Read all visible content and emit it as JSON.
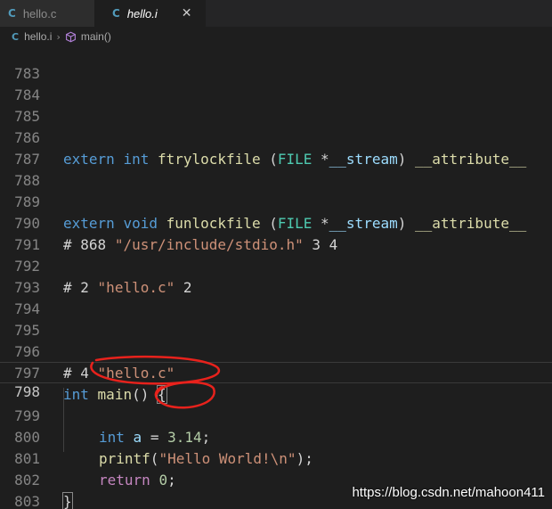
{
  "tabs": [
    {
      "icon": "C",
      "label": "hello.c",
      "active": false
    },
    {
      "icon": "C",
      "label": "hello.i",
      "active": true,
      "close": "✕"
    }
  ],
  "breadcrumb": {
    "file_icon": "C",
    "file": "hello.i",
    "separator": "›",
    "symbol": "main()"
  },
  "lines": {
    "l783": {
      "num": "783"
    },
    "l784": {
      "num": "784"
    },
    "l785": {
      "num": "785"
    },
    "l786": {
      "num": "786",
      "t1": "extern",
      "t2": "int",
      "t3": "ftrylockfile",
      "t4": "(",
      "t5": "FILE",
      "t6": " *",
      "t7": "__stream",
      "t8": ")",
      "t9": "__attribute__"
    },
    "l787": {
      "num": "787"
    },
    "l788": {
      "num": "788"
    },
    "l789": {
      "num": "789",
      "t1": "extern",
      "t2": "void",
      "t3": "funlockfile",
      "t4": "(",
      "t5": "FILE",
      "t6": " *",
      "t7": "__stream",
      "t8": ")",
      "t9": "__attribute__"
    },
    "l790": {
      "num": "790",
      "t1": "# 868",
      "t2": "\"/usr/include/stdio.h\"",
      "t3": "3 4"
    },
    "l791": {
      "num": "791"
    },
    "l792": {
      "num": "792",
      "t1": "# 2",
      "t2": "\"hello.c\"",
      "t3": "2"
    },
    "l793": {
      "num": "793"
    },
    "l794": {
      "num": "794"
    },
    "l795": {
      "num": "795"
    },
    "l796": {
      "num": "796",
      "t1": "# 4",
      "t2": "\"hello.c\""
    },
    "l797": {
      "num": "797",
      "t1": "int",
      "t2": "main",
      "t3": "()",
      "t4": "{"
    },
    "l798": {
      "num": "798"
    },
    "l799": {
      "num": "799",
      "t1": "int",
      "t2": "a",
      "t3": "=",
      "t4": "3.14",
      "t5": ";"
    },
    "l800": {
      "num": "800",
      "t1": "printf",
      "t2": "(",
      "t3": "\"Hello World!\\n\"",
      "t4": ");"
    },
    "l801": {
      "num": "801",
      "t1": "return",
      "t2": "0",
      "t3": ";"
    },
    "l802": {
      "num": "802",
      "t1": "}"
    },
    "l803": {
      "num": "803"
    }
  },
  "watermark": "https://blog.csdn.net/mahoon411",
  "colors": {
    "annotation_red": "#e8221c"
  }
}
